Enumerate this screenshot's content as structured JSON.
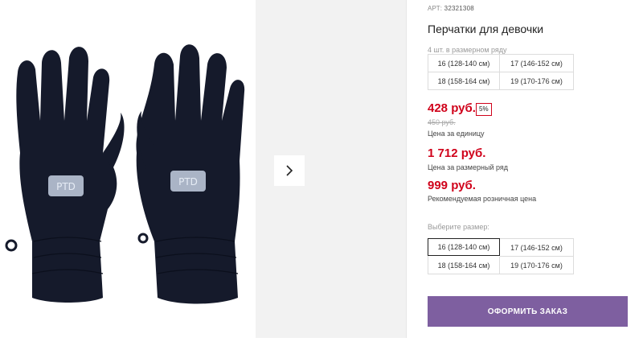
{
  "product": {
    "sku_prefix": "АРТ:",
    "sku": "32321308",
    "title": "Перчатки для девочки",
    "pack_note": "4 шт. в размерном ряду",
    "pack_sizes": [
      "16 (128-140 см)",
      "17 (146-152 см)",
      "18 (158-164 см)",
      "19 (170-176 см)"
    ],
    "image_icon": "gloves-image",
    "patch_label": "PTD"
  },
  "pricing": {
    "unit_price": "428 руб.",
    "discount": "5%",
    "old_price": "450 руб.",
    "unit_label": "Цена за единицу",
    "row_price": "1 712 руб.",
    "row_label": "Цена за размерный ряд",
    "rrp_price": "999 руб.",
    "rrp_label": "Рекомендуемая розничная цена",
    "price_color": "#d0021b"
  },
  "size_select": {
    "label": "Выберите размер:",
    "options": [
      "16 (128-140 см)",
      "17 (146-152 см)",
      "18 (158-164 см)",
      "19 (170-176 см)"
    ],
    "selected": "16 (128-140 см)"
  },
  "actions": {
    "order_label": "ОФОРМИТЬ ЗАКАЗ",
    "order_color": "#7e5fa0",
    "next_icon": "chevron-right-icon"
  }
}
